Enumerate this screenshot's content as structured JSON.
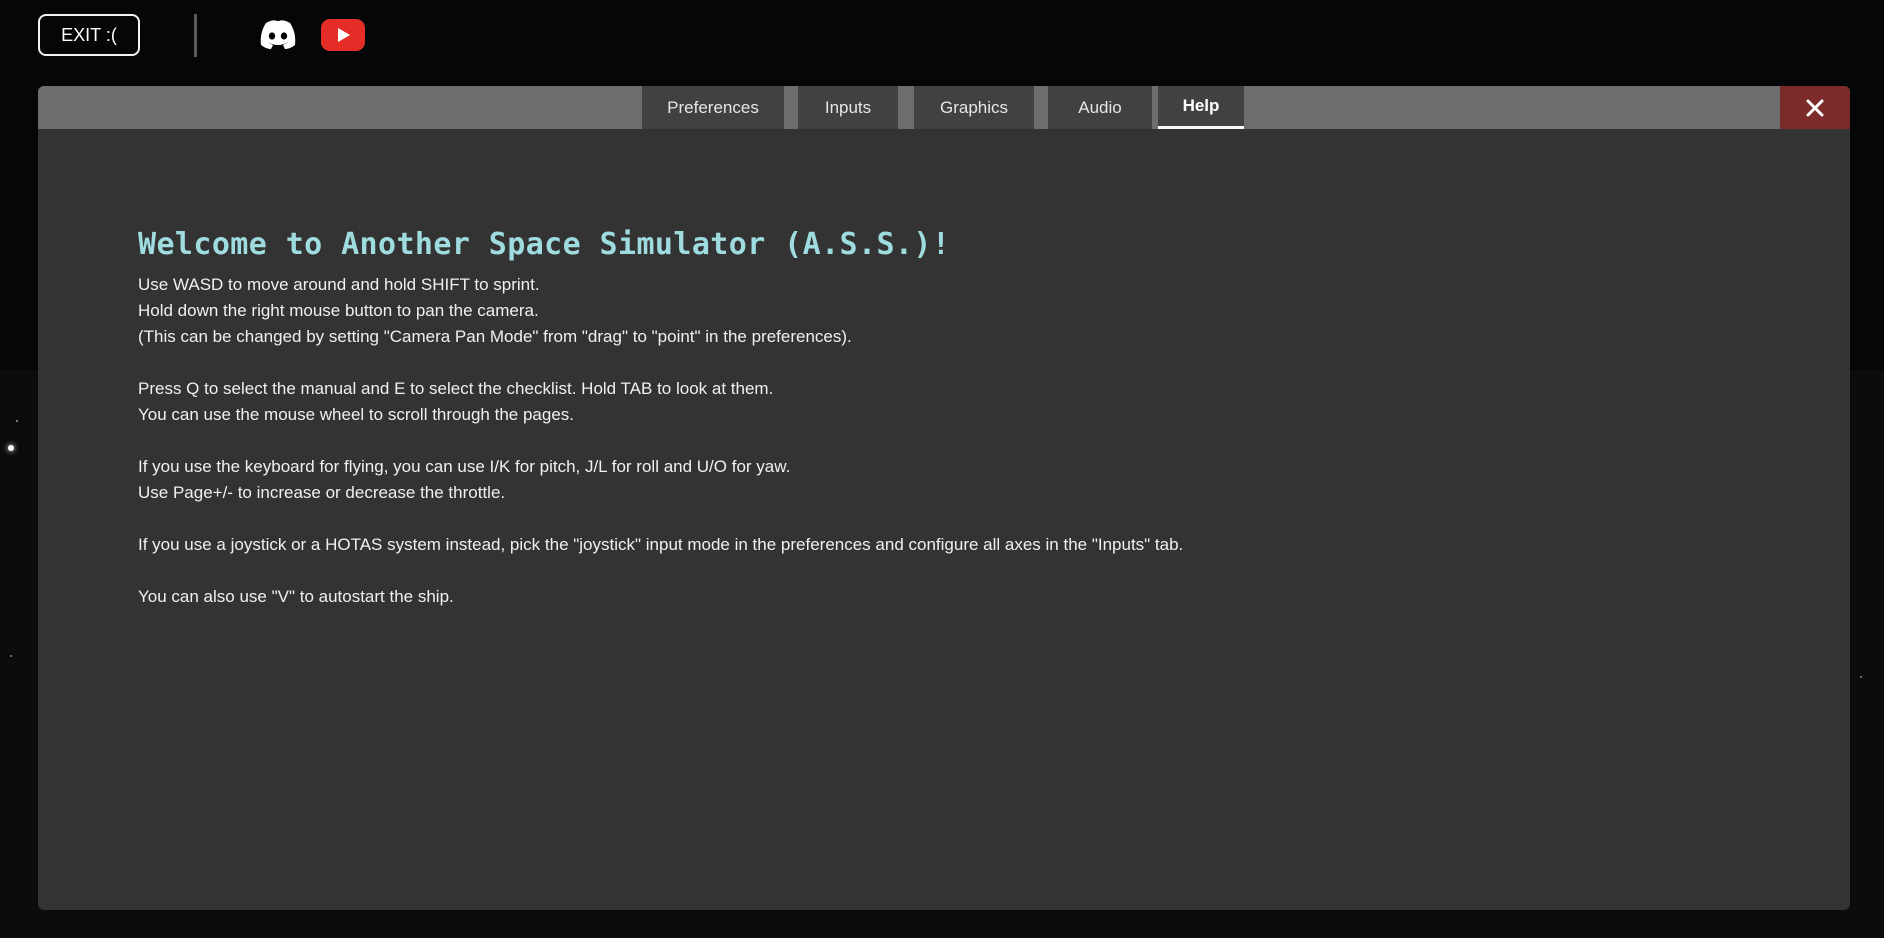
{
  "topbar": {
    "exit_label": "EXIT :(",
    "discord_icon": "discord-icon",
    "youtube_icon": "youtube-icon",
    "youtube_color": "#e52d27"
  },
  "settings": {
    "tabs": [
      {
        "label": "Preferences"
      },
      {
        "label": "Inputs"
      },
      {
        "label": "Graphics"
      },
      {
        "label": "Audio"
      },
      {
        "label": "Help",
        "active": true
      }
    ],
    "close_icon": "close-icon",
    "close_color": "#7b2b2a"
  },
  "help": {
    "title": "Welcome to Another Space Simulator (A.S.S.)!",
    "title_color": "#9fdce0",
    "lines": [
      "Use WASD to move around and hold SHIFT to sprint.",
      "Hold down the right mouse button to pan the camera.",
      "(This can be changed by setting \"Camera Pan Mode\" from \"drag\" to \"point\" in the preferences).",
      "",
      "Press Q to select the manual and E to select the checklist. Hold TAB to look at them.",
      "You can use the mouse wheel to scroll through the pages.",
      "",
      "If you use the keyboard for flying, you can use I/K for pitch, J/L for roll and U/O for yaw.",
      "Use Page+/- to increase or decrease the throttle.",
      "",
      "If you use a joystick or a HOTAS system instead, pick the \"joystick\" input mode in the preferences and configure all axes in the \"Inputs\" tab.",
      "",
      "You can also use \"V\" to autostart the ship."
    ]
  }
}
